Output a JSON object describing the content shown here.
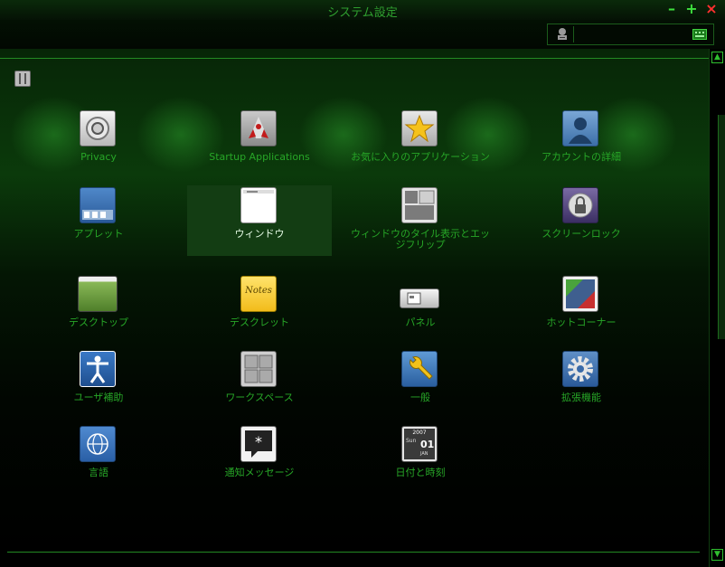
{
  "window": {
    "title": "システム設定",
    "minimize": "–",
    "maximize": "+",
    "close": "×"
  },
  "search": {
    "value": "",
    "placeholder": ""
  },
  "items": [
    {
      "label": "Privacy",
      "icon": "privacy-icon"
    },
    {
      "label": "Startup Applications",
      "icon": "startup-rocket-icon"
    },
    {
      "label": "お気に入りのアプリケーション",
      "icon": "favorite-star-icon"
    },
    {
      "label": "アカウントの詳細",
      "icon": "account-icon"
    },
    {
      "label": "アプレット",
      "icon": "applet-icon"
    },
    {
      "label": "ウィンドウ",
      "icon": "window-icon"
    },
    {
      "label": "ウィンドウのタイル表示とエッジフリップ",
      "icon": "window-tiling-icon"
    },
    {
      "label": "スクリーンロック",
      "icon": "lock-icon"
    },
    {
      "label": "デスクトップ",
      "icon": "desktop-icon"
    },
    {
      "label": "デスクレット",
      "icon": "desklet-note-icon"
    },
    {
      "label": "パネル",
      "icon": "panel-icon"
    },
    {
      "label": "ホットコーナー",
      "icon": "hot-corner-icon"
    },
    {
      "label": "ユーザ補助",
      "icon": "accessibility-icon"
    },
    {
      "label": "ワークスペース",
      "icon": "workspace-icon"
    },
    {
      "label": "一般",
      "icon": "wrench-icon"
    },
    {
      "label": "拡張機能",
      "icon": "gear-icon"
    },
    {
      "label": "言語",
      "icon": "globe-icon"
    },
    {
      "label": "通知メッセージ",
      "icon": "notification-icon"
    },
    {
      "label": "日付と時刻",
      "icon": "calendar-clock-icon"
    }
  ],
  "calendar_icon": {
    "year": "2007",
    "day": "Sun",
    "date": "01",
    "month": "JAN"
  },
  "desklet_icon_text": "Notes",
  "selected_index": 5
}
